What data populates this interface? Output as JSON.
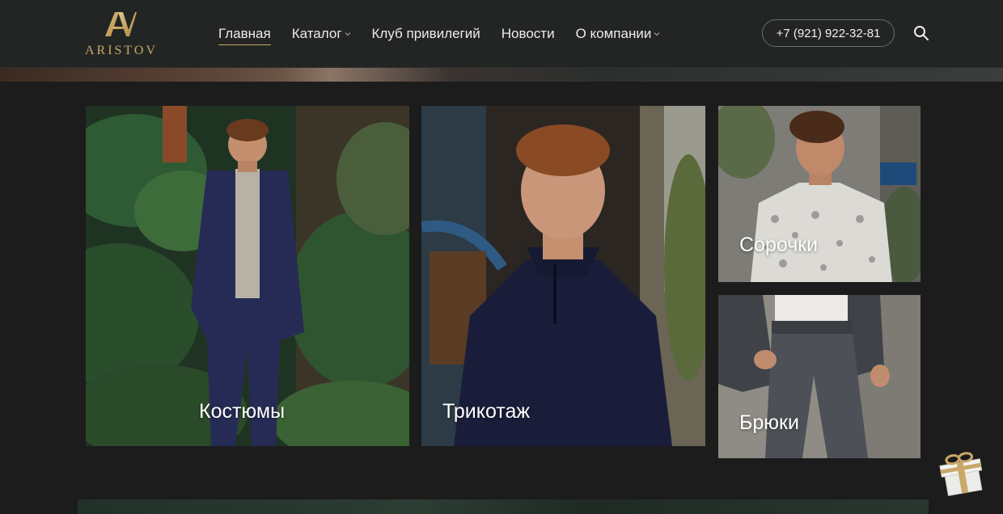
{
  "header": {
    "logo_text": "ARISTOV",
    "nav": [
      {
        "label": "Главная",
        "active": true,
        "has_dropdown": false
      },
      {
        "label": "Каталог",
        "active": false,
        "has_dropdown": true
      },
      {
        "label": "Клуб привилегий",
        "active": false,
        "has_dropdown": false
      },
      {
        "label": "Новости",
        "active": false,
        "has_dropdown": false
      },
      {
        "label": "О компании",
        "active": false,
        "has_dropdown": true
      }
    ],
    "phone": "+7 (921) 922-32-81",
    "search_icon": "search-icon"
  },
  "categories": [
    {
      "label": "Костюмы"
    },
    {
      "label": "Трикотаж"
    },
    {
      "label": "Сорочки"
    },
    {
      "label": "Брюки"
    }
  ],
  "floating": {
    "gift_icon": "gift-icon"
  },
  "colors": {
    "header_bg": "#222523",
    "page_bg": "#1c1c1c",
    "accent_gold": "#c9a86a",
    "text": "#ececec"
  }
}
